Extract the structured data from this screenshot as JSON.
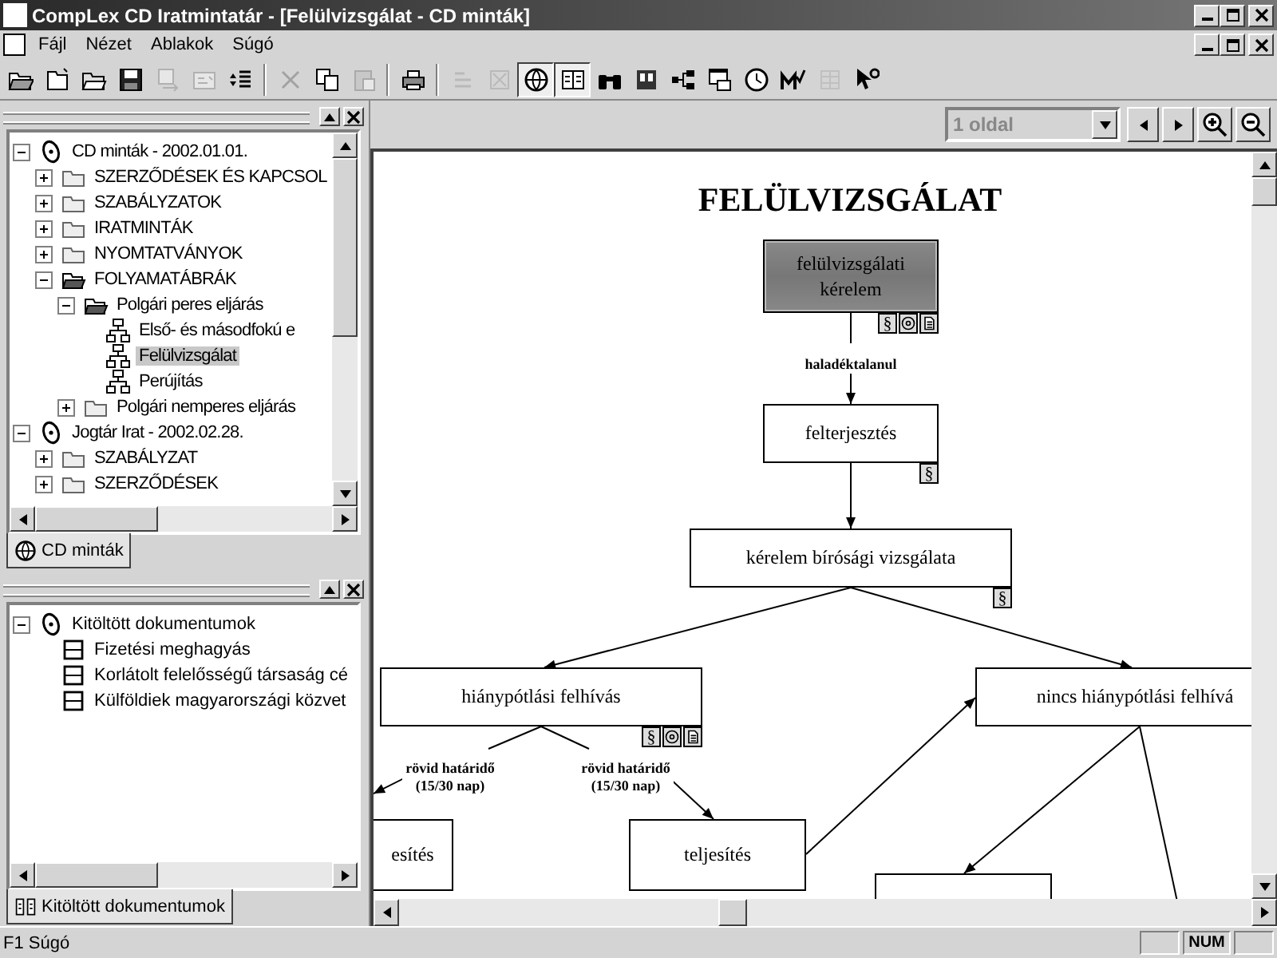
{
  "window": {
    "title": "CompLex CD Iratmintatár - [Felülvizsgálat - CD minták]"
  },
  "menu": [
    {
      "label": "Fájl"
    },
    {
      "label": "Nézet"
    },
    {
      "label": "Ablakok"
    },
    {
      "label": "Súgó"
    }
  ],
  "toolbar": [
    {
      "kind": "open",
      "disabled": false,
      "pressed": false
    },
    {
      "kind": "new",
      "disabled": false,
      "pressed": false
    },
    {
      "kind": "folder",
      "disabled": false,
      "pressed": false
    },
    {
      "kind": "save",
      "disabled": false,
      "pressed": false
    },
    {
      "kind": "export",
      "disabled": true,
      "pressed": false
    },
    {
      "kind": "edit",
      "disabled": true,
      "pressed": false
    },
    {
      "kind": "list",
      "disabled": false,
      "pressed": false
    },
    {
      "kind": "separator"
    },
    {
      "kind": "delete",
      "disabled": true,
      "pressed": false
    },
    {
      "kind": "copy",
      "disabled": false,
      "pressed": false
    },
    {
      "kind": "paste",
      "disabled": true,
      "pressed": false
    },
    {
      "kind": "separator"
    },
    {
      "kind": "print",
      "disabled": false,
      "pressed": false
    },
    {
      "kind": "separator"
    },
    {
      "kind": "lines",
      "disabled": true,
      "pressed": false
    },
    {
      "kind": "cancel",
      "disabled": true,
      "pressed": false
    },
    {
      "kind": "globe",
      "disabled": false,
      "pressed": true
    },
    {
      "kind": "columns",
      "disabled": false,
      "pressed": true
    },
    {
      "kind": "binoculars",
      "disabled": false,
      "pressed": false
    },
    {
      "kind": "book",
      "disabled": false,
      "pressed": false
    },
    {
      "kind": "tree",
      "disabled": false,
      "pressed": false
    },
    {
      "kind": "window",
      "disabled": false,
      "pressed": false
    },
    {
      "kind": "clock",
      "disabled": false,
      "pressed": false
    },
    {
      "kind": "mark",
      "disabled": false,
      "pressed": false
    },
    {
      "kind": "grid",
      "disabled": true,
      "pressed": false
    },
    {
      "kind": "help",
      "disabled": false,
      "pressed": false
    }
  ],
  "panes": [
    {
      "tree": [
        {
          "label": "CD minták - 2002.01.01.",
          "kind": "cd",
          "expanded": true,
          "selected": false,
          "children": [
            {
              "label": "SZERZŐDÉSEK ÉS KAPCSOL",
              "kind": "folder",
              "expanded": false,
              "selected": false
            },
            {
              "label": "SZABÁLYZATOK",
              "kind": "folder",
              "expanded": false,
              "selected": false
            },
            {
              "label": "IRATMINTÁK",
              "kind": "folder",
              "expanded": false,
              "selected": false
            },
            {
              "label": "NYOMTATVÁNYOK",
              "kind": "folder",
              "expanded": false,
              "selected": false
            },
            {
              "label": "FOLYAMATÁBRÁK",
              "kind": "folder",
              "expanded": true,
              "selected": false,
              "children": [
                {
                  "label": "Polgári peres eljárás",
                  "kind": "folder",
                  "expanded": true,
                  "selected": false,
                  "children": [
                    {
                      "label": "Első- és másodfokú e",
                      "kind": "diagram",
                      "selected": false
                    },
                    {
                      "label": "Felülvizsgálat",
                      "kind": "diagram",
                      "selected": true
                    },
                    {
                      "label": "Perújítás",
                      "kind": "diagram",
                      "selected": false
                    }
                  ]
                },
                {
                  "label": "Polgári nemperes eljárás",
                  "kind": "folder",
                  "expanded": false,
                  "selected": false
                }
              ]
            }
          ]
        },
        {
          "label": "Jogtár Irat - 2002.02.28.",
          "kind": "cd",
          "expanded": true,
          "selected": false,
          "children": [
            {
              "label": "SZABÁLYZAT",
              "kind": "folder",
              "expanded": false,
              "selected": false
            },
            {
              "label": "SZERZŐDÉSEK",
              "kind": "folder",
              "expanded": false,
              "selected": false
            }
          ]
        }
      ],
      "tabs": [
        {
          "label": "CD minták",
          "kind": "cd",
          "selected": true
        }
      ]
    },
    {
      "tree": [
        {
          "label": "Kitöltött dokumentumok",
          "kind": "cd",
          "expanded": true,
          "selected": false,
          "children": [
            {
              "label": "Fizetési meghagyás",
              "kind": "form",
              "selected": false
            },
            {
              "label": "Korlátolt felelősségű társaság cé",
              "kind": "form",
              "selected": false
            },
            {
              "label": "Külföldiek magyarországi közvet",
              "kind": "form",
              "selected": false
            }
          ]
        }
      ],
      "tabs": [
        {
          "label": "Kitöltött dokumentumok",
          "kind": "columns",
          "selected": true
        }
      ]
    }
  ],
  "viewer": {
    "page_select": {
      "value": "1 oldal",
      "disabled": true
    },
    "diagram": {
      "title": "FELÜLVIZSGÁLAT",
      "nodes": [
        {
          "text": "felülvizsgálati kérelem",
          "highlighted": true,
          "badges": [
            {
              "kind": "text",
              "text": "§"
            },
            {
              "kind": "disc"
            },
            {
              "kind": "page"
            }
          ]
        },
        {
          "text": "felterjesztés",
          "highlighted": false,
          "badges": [
            {
              "kind": "text",
              "text": "§"
            }
          ]
        },
        {
          "text": "kérelem bírósági vizsgálata",
          "highlighted": false,
          "badges": [
            {
              "kind": "text",
              "text": "§"
            }
          ]
        },
        {
          "text": "hiánypótlási felhívás",
          "highlighted": false,
          "badges": [
            {
              "kind": "text",
              "text": "§"
            },
            {
              "kind": "disc"
            },
            {
              "kind": "page"
            }
          ]
        },
        {
          "text": "nincs hiánypótlási felhívá",
          "highlighted": false
        },
        {
          "text": "esítés",
          "highlighted": false
        },
        {
          "text": "teljesítés",
          "highlighted": false
        },
        {
          "highlighted": false
        }
      ],
      "edge_labels": [
        "haladéktalanul",
        "rövid határidő (15/30 nap)",
        "rövid határidő (15/30 nap)"
      ]
    }
  },
  "status_bar": {
    "text": "F1 Súgó",
    "indicators": [
      "NUM"
    ]
  }
}
